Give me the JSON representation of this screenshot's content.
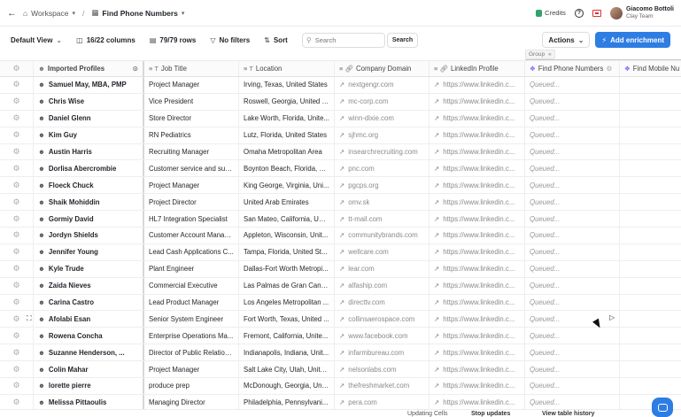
{
  "topbar": {
    "workspace": "Workspace",
    "table_name": "Find Phone Numbers",
    "credits_label": "Credits",
    "user_name": "Giacomo Bottoli",
    "user_team": "Clay Team"
  },
  "toolbar": {
    "view": "Default View",
    "columns": "16/22 columns",
    "rows": "79/79 rows",
    "filters": "No filters",
    "sort": "Sort",
    "search_placeholder": "Search",
    "search_button": "Search",
    "actions": "Actions",
    "add_enrichment": "Add enrichment"
  },
  "group_label": "Group",
  "columns": [
    "Imported Profiles",
    "Job Title",
    "Location",
    "Company Domain",
    "LinkedIn Profile",
    "Find Phone Numbers",
    "Find Mobile Nu"
  ],
  "rows": [
    {
      "name": "Samuel May, MBA, PMP",
      "title": "Project Manager",
      "location": "Irving, Texas, United States",
      "domain": "nextgengr.com",
      "linkedin": "https://www.linkedin.c...",
      "status": "Queued..."
    },
    {
      "name": "Chris Wise",
      "title": "Vice President",
      "location": "Roswell, Georgia, United St...",
      "domain": "mc-corp.com",
      "linkedin": "https://www.linkedin.c...",
      "status": "Queued..."
    },
    {
      "name": "Daniel Glenn",
      "title": "Store Director",
      "location": "Lake Worth, Florida, Unite...",
      "domain": "winn-dixie.com",
      "linkedin": "https://www.linkedin.c...",
      "status": "Queued..."
    },
    {
      "name": "Kim Guy",
      "title": "RN Pediatrics",
      "location": "Lutz, Florida, United States",
      "domain": "sjhmc.org",
      "linkedin": "https://www.linkedin.c...",
      "status": "Queued..."
    },
    {
      "name": "Austin Harris",
      "title": "Recruiting Manager",
      "location": "Omaha Metropolitan Area",
      "domain": "insearchrecruiting.com",
      "linkedin": "https://www.linkedin.c...",
      "status": "Queued..."
    },
    {
      "name": "Dorlisa Abercrombie",
      "title": "Customer service and sup...",
      "location": "Boynton Beach, Florida, Uni...",
      "domain": "pnc.com",
      "linkedin": "https://www.linkedin.c...",
      "status": "Queued..."
    },
    {
      "name": "Floeck Chuck",
      "title": "Project Manager",
      "location": "King George, Virginia, Uni...",
      "domain": "pgcps.org",
      "linkedin": "https://www.linkedin.c...",
      "status": "Queued..."
    },
    {
      "name": "Shaik Mohiddin",
      "title": "Project Director",
      "location": "United Arab Emirates",
      "domain": "omv.sk",
      "linkedin": "https://www.linkedin.c...",
      "status": "Queued..."
    },
    {
      "name": "Gormiy David",
      "title": "HL7 Integration Specialist",
      "location": "San Mateo, California, Unit...",
      "domain": "tt-mail.com",
      "linkedin": "https://www.linkedin.c...",
      "status": "Queued..."
    },
    {
      "name": "Jordyn Shields",
      "title": "Customer Account Manager",
      "location": "Appleton, Wisconsin, Unit...",
      "domain": "communitybrands.com",
      "linkedin": "https://www.linkedin.c...",
      "status": "Queued..."
    },
    {
      "name": "Jennifer Young",
      "title": "Lead Cash Applications C...",
      "location": "Tampa, Florida, United St...",
      "domain": "wellcare.com",
      "linkedin": "https://www.linkedin.c...",
      "status": "Queued..."
    },
    {
      "name": "Kyle Trude",
      "title": "Plant Engineer",
      "location": "Dallas-Fort Worth Metropi...",
      "domain": "lear.com",
      "linkedin": "https://www.linkedin.c...",
      "status": "Queued..."
    },
    {
      "name": "Zaida Nieves",
      "title": "Commercial Executive",
      "location": "Las Palmas de Gran Cana...",
      "domain": "alfaship.com",
      "linkedin": "https://www.linkedin.c...",
      "status": "Queued..."
    },
    {
      "name": "Carina Castro",
      "title": "Lead Product Manager",
      "location": "Los Angeles Metropolitan ...",
      "domain": "directtv.com",
      "linkedin": "https://www.linkedin.c...",
      "status": "Queued..."
    },
    {
      "name": "Afolabi Esan",
      "title": "Senior System Engineer",
      "location": "Fort Worth, Texas, United ...",
      "domain": "collinsaerospace.com",
      "linkedin": "https://www.linkedin.c...",
      "status": "Queued..."
    },
    {
      "name": "Rowena Concha",
      "title": "Enterprise Operations Ma...",
      "location": "Fremont, California, Unite...",
      "domain": "www.facebook.com",
      "linkedin": "https://www.linkedin.c...",
      "status": "Queued..."
    },
    {
      "name": "Suzanne Henderson, ...",
      "title": "Director of Public Relation...",
      "location": "Indianapolis, Indiana, Unit...",
      "domain": "infarmbureau.com",
      "linkedin": "https://www.linkedin.c...",
      "status": "Queued..."
    },
    {
      "name": "Colin Mahar",
      "title": "Project Manager",
      "location": "Salt Lake City, Utah, Unite...",
      "domain": "nelsonlabs.com",
      "linkedin": "https://www.linkedin.c...",
      "status": "Queued..."
    },
    {
      "name": "lorette pierre",
      "title": "produce prep",
      "location": "McDonough, Georgia, Unite...",
      "domain": "thefreshmarket.com",
      "linkedin": "https://www.linkedin.c...",
      "status": "Queued..."
    },
    {
      "name": "Melissa Pittaoulis",
      "title": "Managing Director",
      "location": "Philadelphia, Pennsylvani...",
      "domain": "pera.com",
      "linkedin": "https://www.linkedin.c...",
      "status": "Queued..."
    }
  ],
  "footer": {
    "updating": "Updating Cells",
    "stop": "Stop updates",
    "history": "View table history"
  }
}
